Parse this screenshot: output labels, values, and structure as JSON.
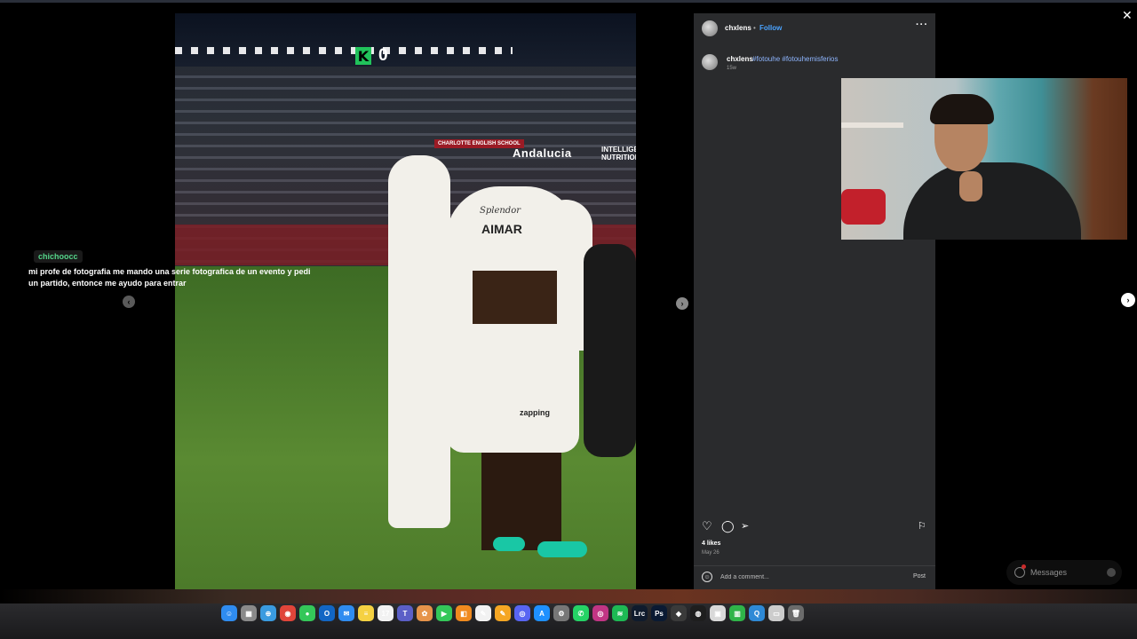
{
  "photo": {
    "score_badge": "K",
    "score_count": "0",
    "banner_andalucia": "Andalucia",
    "banner_intelligent": "INTELLIGENT NUTRITION",
    "banner_charlotte": "CHARLOTTE ENGLISH SCHOOL",
    "jersey_name": "AIMAR",
    "jersey_sponsor": "Splendor",
    "shorts_sponsor": "zapping"
  },
  "chat": {
    "username": "chichoocc",
    "message": "mi profe de fotografia me mando una serie fotografica de un evento y pedi un partido, entonce me ayudo para entrar",
    "username_color": "#55d68a"
  },
  "post": {
    "author": "chxlens",
    "separator": "•",
    "follow_label": "Follow",
    "more_label": "···",
    "caption_user": "chxlens",
    "caption_tags": "#fotouhe #fotouhemisferios",
    "caption_time": "15w",
    "likes": "4 likes",
    "date": "May 26",
    "comment_placeholder": "Add a comment...",
    "post_label": "Post",
    "accent": "#4aa3ff"
  },
  "nav": {
    "prev_label": "‹",
    "next_label": "›",
    "close_label": "✕"
  },
  "messages": {
    "label": "Messages"
  },
  "icons": {
    "like": "heart-icon",
    "comment": "comment-icon",
    "share": "share-icon",
    "save": "bookmark-icon"
  },
  "dock": {
    "apps": [
      {
        "name": "finder",
        "color": "#2f8cf0",
        "glyph": "☺"
      },
      {
        "name": "launchpad",
        "color": "#8a8a8a",
        "glyph": "▦"
      },
      {
        "name": "safari",
        "color": "#3a9be0",
        "glyph": "⊕"
      },
      {
        "name": "chrome",
        "color": "#e0453a",
        "glyph": "◉"
      },
      {
        "name": "messages",
        "color": "#34c759",
        "glyph": "●"
      },
      {
        "name": "outlook",
        "color": "#1266c4",
        "glyph": "O"
      },
      {
        "name": "mail",
        "color": "#2f8cf0",
        "glyph": "✉"
      },
      {
        "name": "notes",
        "color": "#f5d142",
        "glyph": "≡"
      },
      {
        "name": "calendar",
        "color": "#f2f2f2",
        "glyph": "17"
      },
      {
        "name": "teams",
        "color": "#5b5fc7",
        "glyph": "T"
      },
      {
        "name": "photos",
        "color": "#e6934a",
        "glyph": "✿"
      },
      {
        "name": "facetime",
        "color": "#34c759",
        "glyph": "▶"
      },
      {
        "name": "books",
        "color": "#f08a1e",
        "glyph": "◧"
      },
      {
        "name": "freeform",
        "color": "#f2f2f2",
        "glyph": "✎"
      },
      {
        "name": "pages",
        "color": "#f5a623",
        "glyph": "✎"
      },
      {
        "name": "discord",
        "color": "#5865f2",
        "glyph": "◎"
      },
      {
        "name": "app-store",
        "color": "#1e90ff",
        "glyph": "A"
      },
      {
        "name": "system-settings",
        "color": "#777",
        "glyph": "⚙"
      },
      {
        "name": "whatsapp",
        "color": "#25d366",
        "glyph": "✆"
      },
      {
        "name": "instagram",
        "color": "#c13584",
        "glyph": "◎"
      },
      {
        "name": "spotify",
        "color": "#1db954",
        "glyph": "≋"
      },
      {
        "name": "lightroom",
        "color": "#0f1b2d",
        "glyph": "Lrc"
      },
      {
        "name": "photoshop",
        "color": "#0a1a33",
        "glyph": "Ps"
      },
      {
        "name": "davinci",
        "color": "#3a3a3a",
        "glyph": "◆"
      },
      {
        "name": "obs",
        "color": "#1e1e1e",
        "glyph": "◍"
      },
      {
        "name": "preview",
        "color": "#d9d9d9",
        "glyph": "▣"
      },
      {
        "name": "numbers",
        "color": "#2fb449",
        "glyph": "▥"
      },
      {
        "name": "quicktime",
        "color": "#2e89d6",
        "glyph": "Q"
      },
      {
        "name": "screen-recorder",
        "color": "#ccc",
        "glyph": "▭"
      },
      {
        "name": "trash",
        "color": "#6b6b6b",
        "glyph": "🗑"
      }
    ]
  }
}
